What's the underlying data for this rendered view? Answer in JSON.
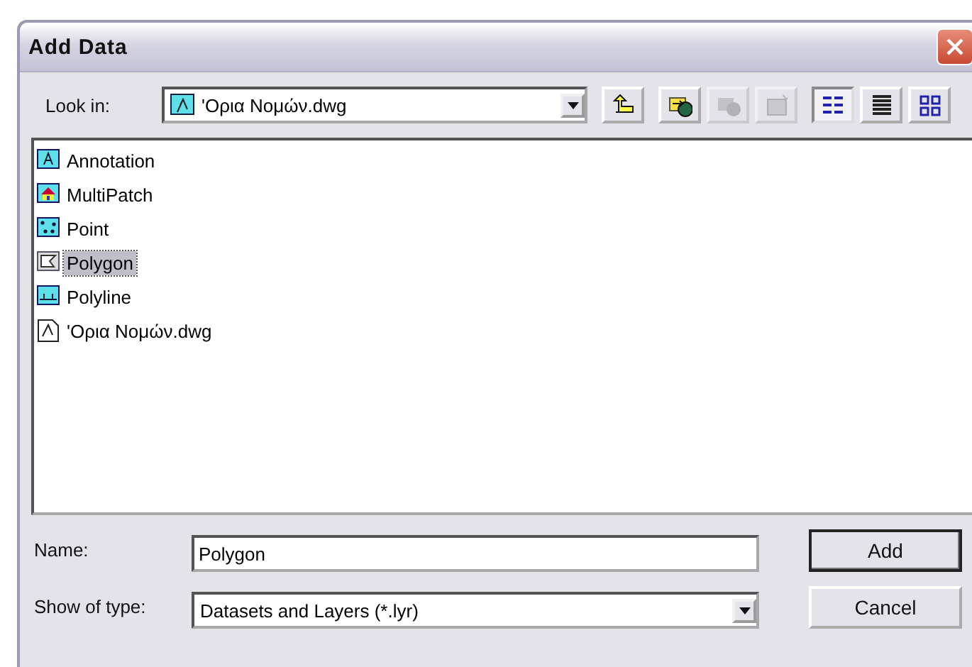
{
  "window": {
    "title": "Add Data"
  },
  "look_in": {
    "label": "Look in:",
    "value": "'Ορια Νομών.dwg"
  },
  "toolbar": [
    {
      "kind": "up",
      "disabled": false,
      "selected": false
    },
    {
      "kind": "connect",
      "disabled": false,
      "selected": false
    },
    {
      "kind": "disconnect",
      "disabled": true,
      "selected": false
    },
    {
      "kind": "properties",
      "disabled": true,
      "selected": false
    },
    {
      "kind": "list",
      "disabled": false,
      "selected": true
    },
    {
      "kind": "details",
      "disabled": false,
      "selected": false
    },
    {
      "kind": "thumbnails",
      "disabled": false,
      "selected": false
    }
  ],
  "items": [
    {
      "kind": "annotation",
      "label": "Annotation",
      "selected": false
    },
    {
      "kind": "multipatch",
      "label": "MultiPatch",
      "selected": false
    },
    {
      "kind": "point",
      "label": "Point",
      "selected": false
    },
    {
      "kind": "polygon",
      "label": "Polygon",
      "selected": true
    },
    {
      "kind": "polyline",
      "label": "Polyline",
      "selected": false
    },
    {
      "kind": "cad",
      "label": "'Ορια Νομών.dwg",
      "selected": false
    }
  ],
  "name": {
    "label": "Name:",
    "value": "Polygon"
  },
  "type": {
    "label": "Show of type:",
    "value": "Datasets and Layers (*.lyr)"
  },
  "buttons": [
    "Add",
    "Cancel"
  ]
}
